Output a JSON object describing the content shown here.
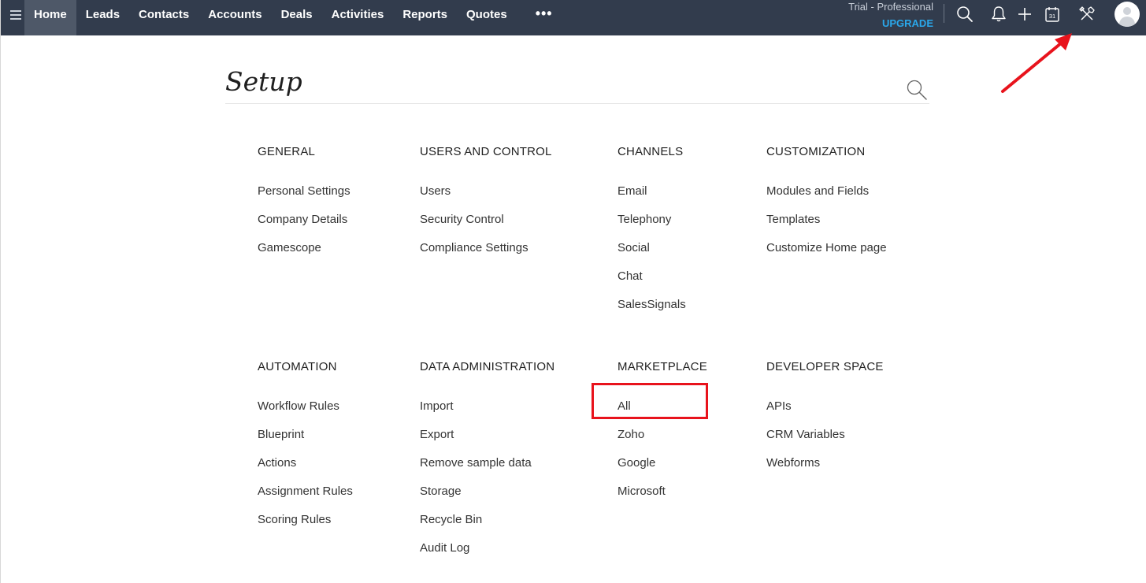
{
  "topbar": {
    "menu_icon": "hamburger-icon",
    "nav": [
      "Home",
      "Leads",
      "Contacts",
      "Accounts",
      "Deals",
      "Activities",
      "Reports",
      "Quotes"
    ],
    "active_nav": "Home",
    "more_label": "•••",
    "trial_label": "Trial - Professional",
    "upgrade_label": "UPGRADE",
    "calendar_day": "31",
    "icons": [
      "search-icon",
      "bell-icon",
      "plus-icon",
      "calendar-icon",
      "setup-tools-icon",
      "avatar"
    ],
    "colors": {
      "bar": "#323c4d",
      "active": "#4e5868",
      "upgrade": "#2aa7ea"
    }
  },
  "page": {
    "title": "Setup",
    "search_icon": "search-icon"
  },
  "sections": {
    "general": {
      "title": "GENERAL",
      "items": [
        "Personal Settings",
        "Company Details",
        "Gamescope"
      ]
    },
    "users": {
      "title": "USERS AND CONTROL",
      "items": [
        "Users",
        "Security Control",
        "Compliance Settings"
      ]
    },
    "channels": {
      "title": "CHANNELS",
      "items": [
        "Email",
        "Telephony",
        "Social",
        "Chat",
        "SalesSignals"
      ]
    },
    "customization": {
      "title": "CUSTOMIZATION",
      "items": [
        "Modules and Fields",
        "Templates",
        "Customize Home page"
      ]
    },
    "automation": {
      "title": "AUTOMATION",
      "items": [
        "Workflow Rules",
        "Blueprint",
        "Actions",
        "Assignment Rules",
        "Scoring Rules"
      ]
    },
    "data_admin": {
      "title": "DATA ADMINISTRATION",
      "items": [
        "Import",
        "Export",
        "Remove sample data",
        "Storage",
        "Recycle Bin",
        "Audit Log"
      ]
    },
    "marketplace": {
      "title": "MARKETPLACE",
      "items": [
        "All",
        "Zoho",
        "Google",
        "Microsoft"
      ]
    },
    "developer": {
      "title": "DEVELOPER SPACE",
      "items": [
        "APIs",
        "CRM Variables",
        "Webforms"
      ]
    }
  },
  "annotations": {
    "highlight_color": "#e8131c",
    "highlighted_item": "All",
    "arrow_target": "setup-tools-icon"
  }
}
